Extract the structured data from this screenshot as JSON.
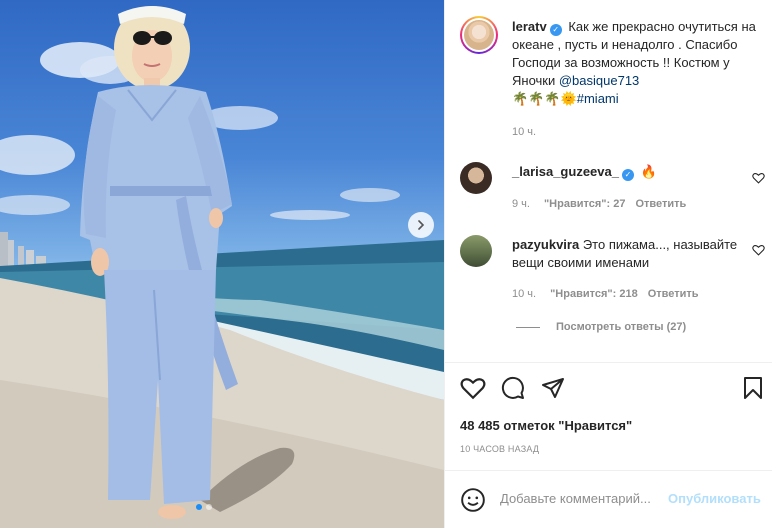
{
  "post": {
    "username": "leratv",
    "caption_text": "Как же прекрасно очутиться на океане , пусть и ненадолго . Спасибо Господи за возможность !! Костюм у Яночки",
    "caption_mention": "@basique713",
    "caption_emoji": "🌴🌴🌴🌞",
    "caption_hashtag": "#miami",
    "time": "10 ч."
  },
  "comments": [
    {
      "username": "_larisa_guzeeva_",
      "text": "🔥",
      "time": "9 ч.",
      "likes": "\"Нравится\": 27",
      "reply": "Ответить"
    },
    {
      "username": "pazyukvira",
      "text": "Это пижама..., называйте вещи своими именами",
      "time": "10 ч.",
      "likes": "\"Нравится\": 218",
      "reply": "Ответить"
    }
  ],
  "view_replies": "Посмотреть ответы (27)",
  "likes_count": "48 485 отметок \"Нравится\"",
  "post_time": "10 ЧАСОВ НАЗАД",
  "comment_input": {
    "placeholder": "Добавьте комментарий...",
    "publish": "Опубликовать"
  },
  "icons": [
    "heart-icon",
    "comment-icon",
    "share-icon",
    "bookmark-icon",
    "emoji-icon",
    "chevron-right-icon",
    "verified-icon"
  ],
  "colors": {
    "link": "#00376b",
    "verified": "#3897f0",
    "publish_disabled": "#b2dffc",
    "carousel_active_dot": "#1b8df8"
  }
}
